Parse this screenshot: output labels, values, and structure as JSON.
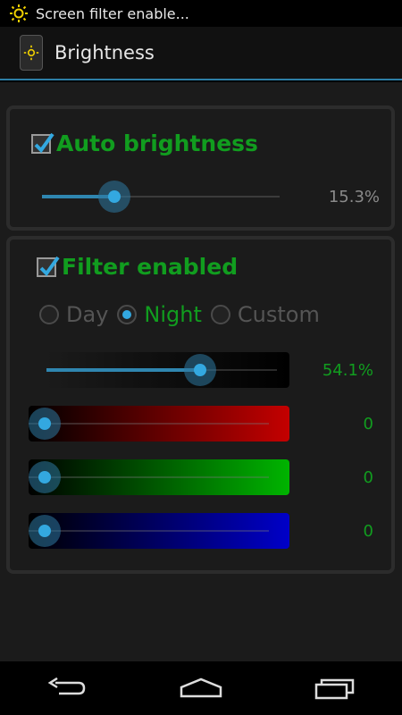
{
  "status_bar": {
    "notification_text": "Screen filter enable..."
  },
  "action_bar": {
    "title": "Brightness"
  },
  "auto_brightness": {
    "label": "Auto brightness",
    "checked": true,
    "slider_percent": 15.3,
    "value_text": "15.3%"
  },
  "filter": {
    "label": "Filter enabled",
    "checked": true,
    "modes": [
      {
        "label": "Day",
        "selected": false
      },
      {
        "label": "Night",
        "selected": true
      },
      {
        "label": "Custom",
        "selected": false
      }
    ],
    "intensity": {
      "percent": 54.1,
      "value_text": "54.1%"
    },
    "red": {
      "value_text": "0",
      "level": 0
    },
    "green": {
      "value_text": "0",
      "level": 0
    },
    "blue": {
      "value_text": "0",
      "level": 0
    }
  },
  "colors": {
    "accent": "#33a8e0",
    "label_green": "#119d1f"
  }
}
